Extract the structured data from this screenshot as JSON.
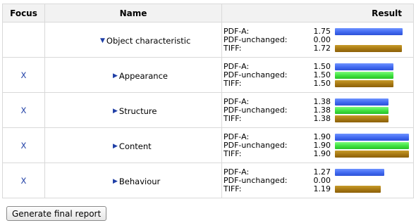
{
  "table": {
    "headers": {
      "focus": "Focus",
      "name": "Name",
      "result": "Result"
    },
    "rows": [
      {
        "focus": "",
        "expanded": true,
        "name": "Object characteristic",
        "indent": 1,
        "results": [
          {
            "label": "PDF-A:",
            "value": "1.75",
            "bar": 1.75,
            "color": "blue"
          },
          {
            "label": "PDF-unchanged:",
            "value": "0.00",
            "bar": 0.0,
            "color": "green"
          },
          {
            "label": "TIFF:",
            "value": "1.72",
            "bar": 1.72,
            "color": "gold"
          }
        ]
      },
      {
        "focus": "X",
        "expanded": false,
        "name": "Appearance",
        "indent": 2,
        "results": [
          {
            "label": "PDF-A:",
            "value": "1.50",
            "bar": 1.5,
            "color": "blue"
          },
          {
            "label": "PDF-unchanged:",
            "value": "1.50",
            "bar": 1.5,
            "color": "green"
          },
          {
            "label": "TIFF:",
            "value": "1.50",
            "bar": 1.5,
            "color": "gold"
          }
        ]
      },
      {
        "focus": "X",
        "expanded": false,
        "name": "Structure",
        "indent": 2,
        "results": [
          {
            "label": "PDF-A:",
            "value": "1.38",
            "bar": 1.38,
            "color": "blue"
          },
          {
            "label": "PDF-unchanged:",
            "value": "1.38",
            "bar": 1.38,
            "color": "green"
          },
          {
            "label": "TIFF:",
            "value": "1.38",
            "bar": 1.38,
            "color": "gold"
          }
        ]
      },
      {
        "focus": "X",
        "expanded": false,
        "name": "Content",
        "indent": 2,
        "results": [
          {
            "label": "PDF-A:",
            "value": "1.90",
            "bar": 1.9,
            "color": "blue"
          },
          {
            "label": "PDF-unchanged:",
            "value": "1.90",
            "bar": 1.9,
            "color": "green"
          },
          {
            "label": "TIFF:",
            "value": "1.90",
            "bar": 1.9,
            "color": "gold"
          }
        ]
      },
      {
        "focus": "X",
        "expanded": false,
        "name": "Behaviour",
        "indent": 2,
        "results": [
          {
            "label": "PDF-A:",
            "value": "1.27",
            "bar": 1.27,
            "color": "blue"
          },
          {
            "label": "PDF-unchanged:",
            "value": "0.00",
            "bar": 0.0,
            "color": "green"
          },
          {
            "label": "TIFF:",
            "value": "1.19",
            "bar": 1.19,
            "color": "gold"
          }
        ]
      }
    ]
  },
  "icons": {
    "expanded": "triangle-down-icon",
    "collapsed": "triangle-right-icon"
  },
  "colors": {
    "blue": "#4169f0",
    "green": "#3fe03f",
    "gold": "#a67712",
    "link": "#1f3fa6"
  },
  "bar_max": 2.0,
  "actions": {
    "generate_label": "Generate final report"
  }
}
